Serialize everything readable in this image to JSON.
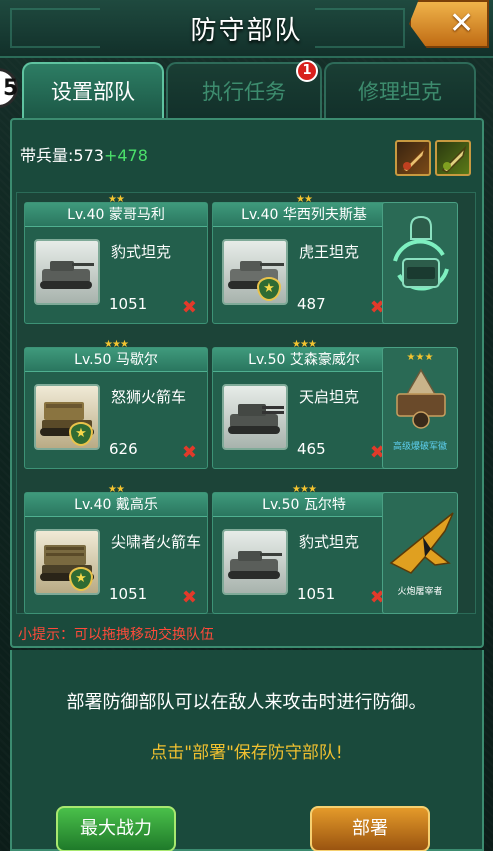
{
  "window": {
    "title": "防守部队",
    "close_label": "✕",
    "side_label": "5"
  },
  "tabs": [
    {
      "label": "设置部队",
      "active": true
    },
    {
      "label": "执行任务",
      "active": false,
      "badge": "1"
    },
    {
      "label": "修理坦克",
      "active": false
    }
  ],
  "troops": {
    "label": "带兵量:573",
    "bonus": "+478"
  },
  "slots": [
    {
      "stars": "★★",
      "header": "Lv.40 蒙哥马利",
      "unit": "豹式坦克",
      "power": "1051",
      "has_rank": false,
      "kind": "tank"
    },
    {
      "stars": "★★",
      "header": "Lv.40 华西列夫斯基",
      "unit": "虎王坦克",
      "power": "487",
      "has_rank": true,
      "kind": "tank"
    },
    {
      "stars": "★★★",
      "header": "Lv.50 马歇尔",
      "unit": "怒狮火箭车",
      "power": "626",
      "has_rank": true,
      "kind": "rocket"
    },
    {
      "stars": "★★★",
      "header": "Lv.50 艾森豪威尔",
      "unit": "天启坦克",
      "power": "465",
      "has_rank": false,
      "kind": "tank"
    },
    {
      "stars": "★★",
      "header": "Lv.40 戴高乐",
      "unit": "尖啸者火箭车",
      "power": "1051",
      "has_rank": true,
      "kind": "rocket"
    },
    {
      "stars": "★★★",
      "header": "Lv.50 瓦尔特",
      "unit": "豹式坦克",
      "power": "1051",
      "has_rank": false,
      "kind": "tank"
    }
  ],
  "side_slots": [
    {
      "label": ""
    },
    {
      "stars": "★★★",
      "label": "高级爆破军徽"
    },
    {
      "label": "火炮屠宰者"
    }
  ],
  "hint": "小提示：可以拖拽移动交换队伍",
  "description": "部署防御部队可以在敌人来攻击时进行防御。",
  "save_hint": "点击\"部署\"保存防守部队!",
  "buttons": {
    "max_power": "最大战力",
    "deploy": "部署"
  },
  "remove_icon": "✖",
  "rank_icon": "★",
  "colors": {
    "accent": "#3c8c70",
    "panel": "#1a4a3c",
    "bonus_green": "#4be06a",
    "hint_red": "#ff4a3a",
    "save_yellow": "#f0c030"
  }
}
